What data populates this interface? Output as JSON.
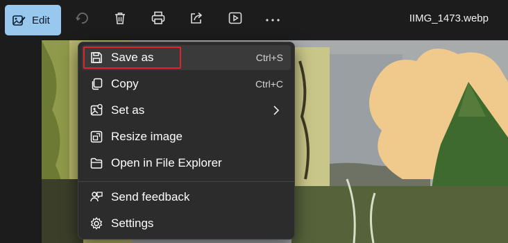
{
  "toolbar": {
    "edit_label": "Edit",
    "filename": "IIMG_1473.webp",
    "icons": [
      "edit-image-icon",
      "rotate-icon",
      "delete-icon",
      "print-icon",
      "share-icon",
      "slideshow-icon",
      "more-icon"
    ]
  },
  "menu": {
    "items": [
      {
        "label": "Save as",
        "shortcut": "Ctrl+S",
        "icon": "save-icon"
      },
      {
        "label": "Copy",
        "shortcut": "Ctrl+C",
        "icon": "copy-icon"
      },
      {
        "label": "Set as",
        "icon": "set-as-icon"
      },
      {
        "label": "Resize image",
        "icon": "resize-icon"
      },
      {
        "label": "Open in File Explorer",
        "icon": "folder-icon"
      },
      {
        "label": "Send feedback",
        "icon": "feedback-icon"
      },
      {
        "label": "Settings",
        "icon": "settings-icon"
      }
    ]
  },
  "colors": {
    "accent": "#99c8ee",
    "highlight_border": "#e0242f",
    "menu_bg": "#2c2c2c"
  }
}
